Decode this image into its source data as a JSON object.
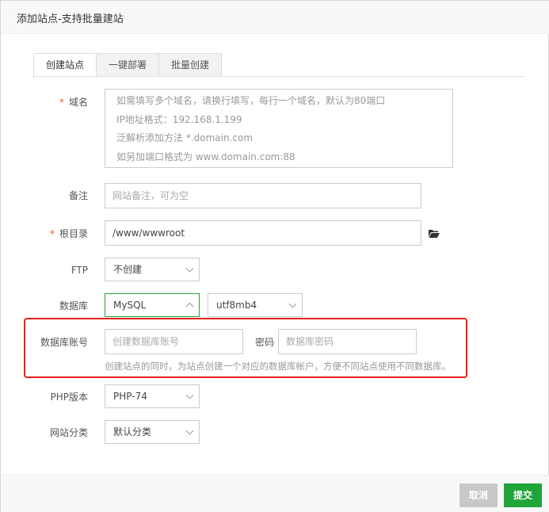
{
  "dialog": {
    "title": "添加站点-支持批量建站"
  },
  "tabs": [
    "创建站点",
    "一键部署",
    "批量创建"
  ],
  "form": {
    "domain": {
      "label": "域名",
      "required_mark": "*",
      "placeholder_lines": [
        "如需填写多个域名，请换行填写，每行一个域名，默认为80端口",
        "IP地址格式：192.168.1.199",
        "泛解析添加方法 *.domain.com",
        "如另加端口格式为 www.domain.com:88"
      ]
    },
    "remark": {
      "label": "备注",
      "placeholder": "网站备注，可为空"
    },
    "root": {
      "label": "根目录",
      "required_mark": "*",
      "value": "/www/wwwroot"
    },
    "ftp": {
      "label": "FTP",
      "value": "不创建"
    },
    "database": {
      "label": "数据库",
      "type": "MySQL",
      "charset": "utf8mb4"
    },
    "db_account": {
      "label": "数据库账号",
      "placeholder": "创建数据库账号",
      "password_label": "密码",
      "password_placeholder": "数据库密码",
      "help": "创建站点的同时，为站点创建一个对应的数据库帐户，方便不同站点使用不同数据库。"
    },
    "php": {
      "label": "PHP版本",
      "value": "PHP-74"
    },
    "category": {
      "label": "网站分类",
      "value": "默认分类"
    }
  },
  "buttons": {
    "cancel": "取消",
    "submit": "提交"
  },
  "colors": {
    "accent": "#20a53a",
    "highlight": "#e5201b",
    "required": "#ff5722"
  }
}
